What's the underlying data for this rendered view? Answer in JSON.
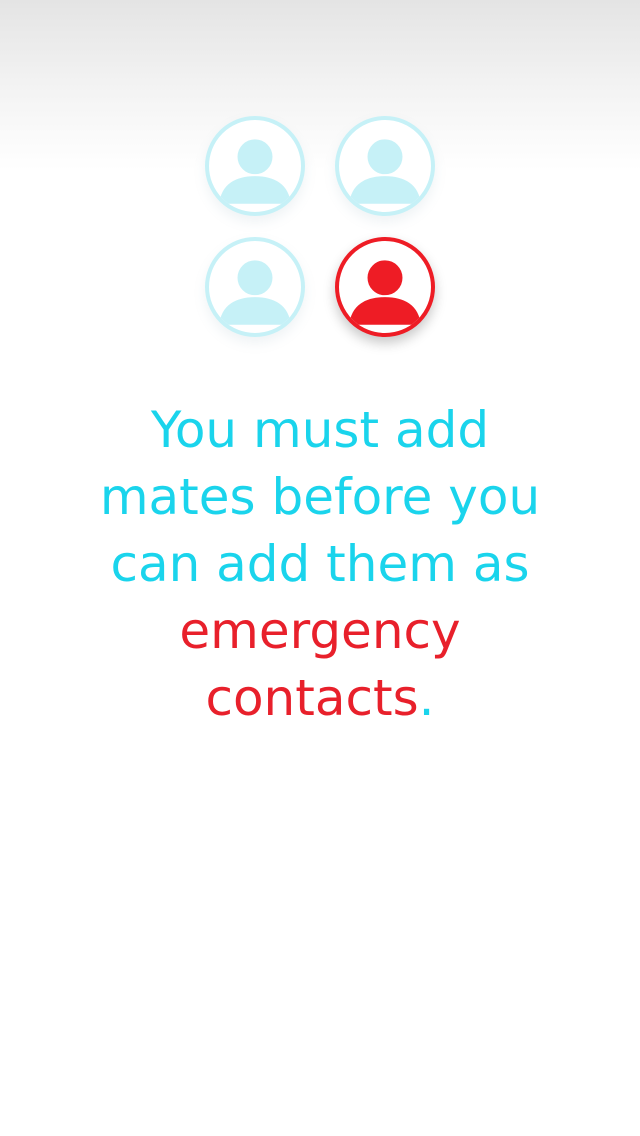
{
  "colors": {
    "primary_cyan": "#1ad4ec",
    "light_cyan": "#c6f1f7",
    "accent_red": "#ee1c25",
    "background": "#ffffff"
  },
  "avatars": [
    {
      "icon": "person-icon",
      "state": "inactive"
    },
    {
      "icon": "person-icon",
      "state": "inactive"
    },
    {
      "icon": "person-icon",
      "state": "inactive"
    },
    {
      "icon": "person-icon",
      "state": "active"
    }
  ],
  "message": {
    "line_1": "You must add",
    "line_2": "mates before you",
    "line_3": "can add them as",
    "highlight_1": "emergency",
    "highlight_2": "contacts",
    "period": "."
  }
}
